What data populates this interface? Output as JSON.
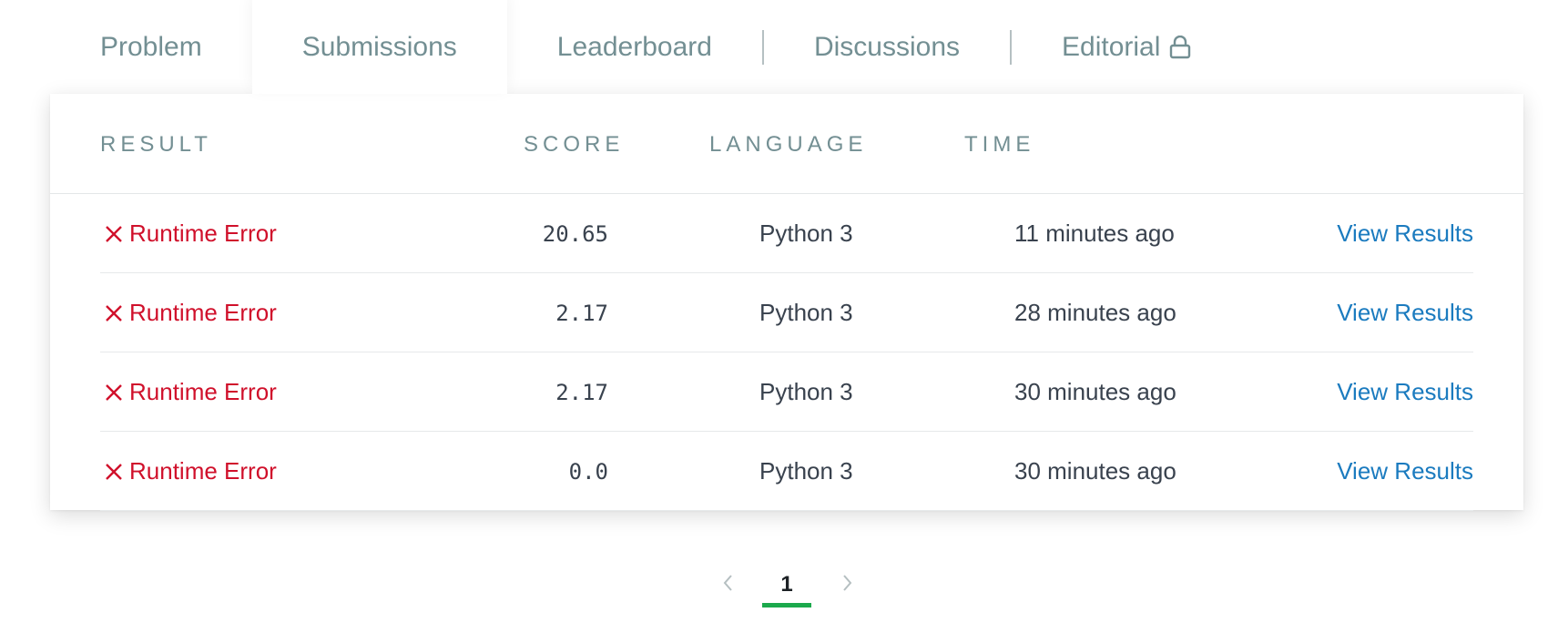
{
  "tabs": [
    {
      "label": "Problem"
    },
    {
      "label": "Submissions"
    },
    {
      "label": "Leaderboard"
    },
    {
      "label": "Discussions"
    },
    {
      "label": "Editorial"
    }
  ],
  "table": {
    "headers": {
      "result": "RESULT",
      "score": "SCORE",
      "language": "LANGUAGE",
      "time": "TIME"
    },
    "rows": [
      {
        "result": "Runtime Error",
        "score": "20.65",
        "language": "Python 3",
        "time": "11 minutes ago",
        "action": "View Results"
      },
      {
        "result": "Runtime Error",
        "score": "2.17",
        "language": "Python 3",
        "time": "28 minutes ago",
        "action": "View Results"
      },
      {
        "result": "Runtime Error",
        "score": "2.17",
        "language": "Python 3",
        "time": "30 minutes ago",
        "action": "View Results"
      },
      {
        "result": "Runtime Error",
        "score": "0.0",
        "language": "Python 3",
        "time": "30 minutes ago",
        "action": "View Results"
      }
    ]
  },
  "pagination": {
    "current_page": "1"
  },
  "icons": {
    "result_icon": "close-x-icon",
    "editorial_icon": "lock-icon",
    "prev_icon": "chevron-left-icon",
    "next_icon": "chevron-right-icon"
  },
  "colors": {
    "error": "#d0102b",
    "link": "#1b7bbf",
    "tab_text": "#738f93",
    "active_page_underline": "#1ba94c"
  }
}
